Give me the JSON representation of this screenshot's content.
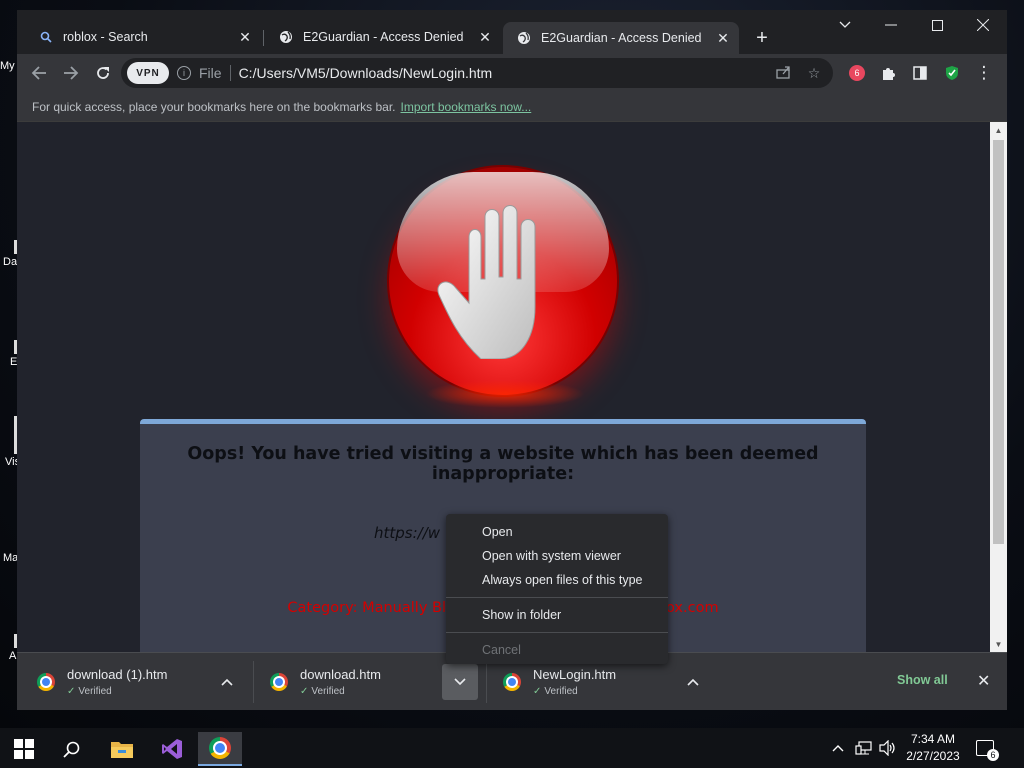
{
  "desktop": {
    "icons": [
      "My",
      "Da",
      "E",
      "Vis",
      "Ma",
      "A"
    ]
  },
  "tabs": [
    {
      "title": "roblox - Search",
      "icon": "search-icon",
      "active": false
    },
    {
      "title": "E2Guardian - Access Denied",
      "icon": "globe-icon",
      "active": false
    },
    {
      "title": "E2Guardian - Access Denied",
      "icon": "globe-icon",
      "active": true
    }
  ],
  "toolbar": {
    "vpn_label": "VPN",
    "scheme_label": "File",
    "url": "C:/Users/VM5/Downloads/NewLogin.htm"
  },
  "bookmarks_bar": {
    "message": "For quick access, place your bookmarks here on the bookmarks bar.",
    "import_link": "Import bookmarks now..."
  },
  "page": {
    "message": "Oops! You have tried visiting a website which has been deemed inappropriate:",
    "blocked_url_fragment": "https://w",
    "category_start": "Category: Manually Bl",
    "category_end": "ox.com",
    "accent_color": "#d40000"
  },
  "context_menu": {
    "items": [
      {
        "label": "Open",
        "disabled": false
      },
      {
        "label": "Open with system viewer",
        "disabled": false
      },
      {
        "label": "Always open files of this type",
        "disabled": false
      },
      {
        "label": "Show in folder",
        "disabled": false
      },
      {
        "label": "Cancel",
        "disabled": true
      }
    ]
  },
  "downloads": {
    "items": [
      {
        "name": "download (1).htm",
        "status": "Verified"
      },
      {
        "name": "download.htm",
        "status": "Verified"
      },
      {
        "name": "NewLogin.htm",
        "status": "Verified"
      }
    ],
    "show_all": "Show all"
  },
  "taskbar": {
    "time": "7:34 AM",
    "date": "2/27/2023",
    "notification_count": "6"
  }
}
